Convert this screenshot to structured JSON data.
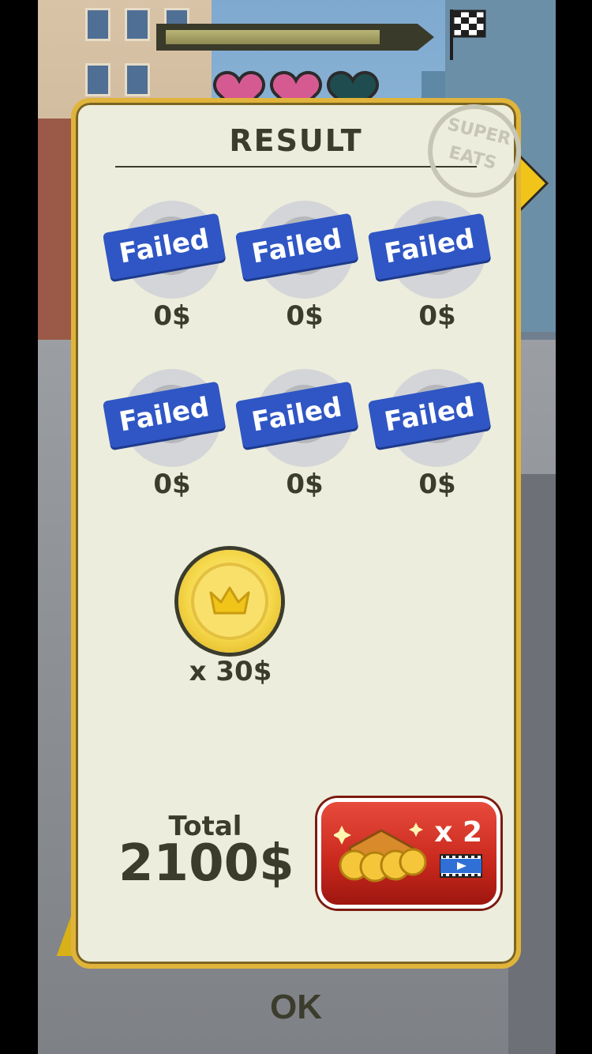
{
  "hud": {
    "progress_fraction": 0.88,
    "lives_total": 3,
    "lives_remaining": 2
  },
  "panel": {
    "title": "RESULT",
    "stamp_line1": "SUPER",
    "stamp_line2": "EATS"
  },
  "orders": [
    {
      "status": "Failed",
      "amount": "0$"
    },
    {
      "status": "Failed",
      "amount": "0$"
    },
    {
      "status": "Failed",
      "amount": "0$"
    },
    {
      "status": "Failed",
      "amount": "0$"
    },
    {
      "status": "Failed",
      "amount": "0$"
    },
    {
      "status": "Failed",
      "amount": "0$"
    }
  ],
  "bonus": {
    "icon": "crown-coin-icon",
    "multiplier_text": "x 30$"
  },
  "total": {
    "label": "Total",
    "value": "2100$"
  },
  "double_button": {
    "label": "x 2",
    "icon": "video-ad-icon"
  },
  "ok_button": {
    "label": "OK"
  },
  "colors": {
    "panel_bg": "#eceddc",
    "panel_border": "#e0b43a",
    "failed_tag": "#2f56c4",
    "double_button": "#d6342a",
    "text_dark": "#3c3c2c"
  }
}
